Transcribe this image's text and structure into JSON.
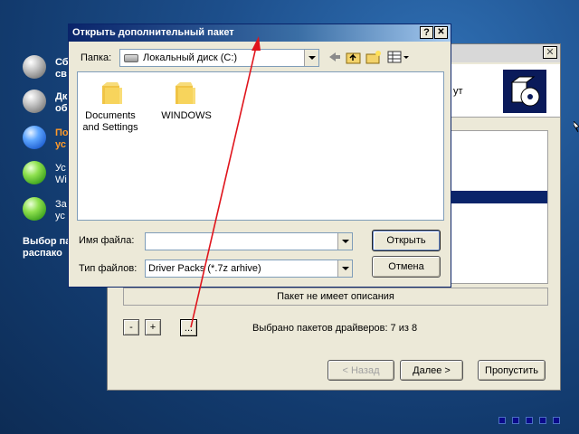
{
  "desktop": {
    "steps": [
      {
        "label": "Сб\nсв",
        "state": "gray"
      },
      {
        "label": "Дк\nоб",
        "state": "gray"
      },
      {
        "label": "По\nус",
        "state": "active"
      },
      {
        "label": "Ус\nWi",
        "state": "green"
      },
      {
        "label": "За\nус",
        "state": "green"
      }
    ],
    "footer_label": "Выбор па\nраспако"
  },
  "installer": {
    "banner_text": "ут",
    "description": "Пакет не имеет описания",
    "minus_label": "-",
    "plus_label": "+",
    "browse_label": "...",
    "status": "Выбрано пакетов драйверов: 7 из 8",
    "back_label": "< Назад",
    "next_label": "Далее >",
    "skip_label": "Пропустить"
  },
  "dialog": {
    "title": "Открыть дополнительный пакет",
    "help_label": "?",
    "close_label": "✕",
    "folder_label": "Папка:",
    "folder_value": "Локальный диск (C:)",
    "items": [
      {
        "name": "Documents\nand Settings"
      },
      {
        "name": "WINDOWS"
      }
    ],
    "filename_label": "Имя файла:",
    "filename_value": "",
    "filetype_label": "Тип файлов:",
    "filetype_value": "Driver Packs (*.7z arhive)",
    "open_label": "Открыть",
    "cancel_label": "Отмена"
  },
  "colors": {
    "title_start": "#0a246a",
    "title_end": "#a6caf0",
    "annotation": "#e0141c",
    "selection": "#0a246a"
  }
}
